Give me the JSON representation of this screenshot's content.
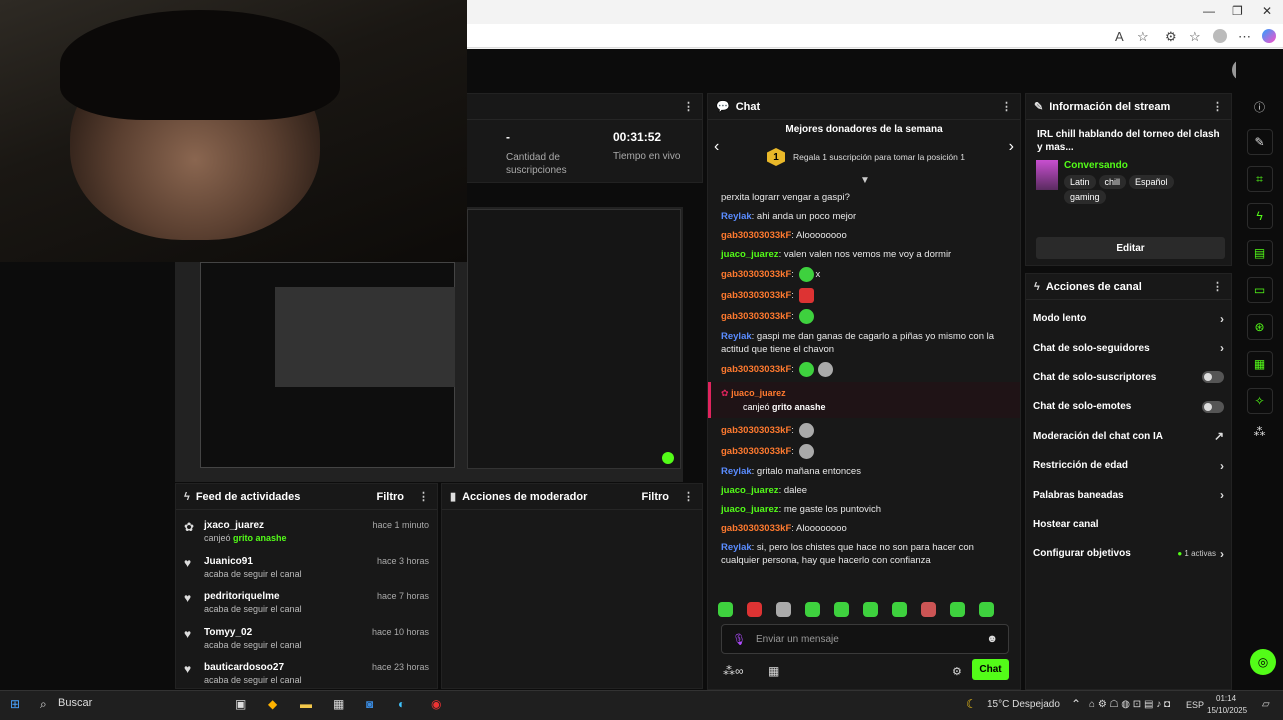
{
  "browser": {
    "window_controls": [
      "—",
      "❐",
      "✕"
    ],
    "address_icons": [
      "text-size",
      "star",
      "extensions",
      "favorites",
      "profile",
      "more",
      "copilot"
    ]
  },
  "stats": {
    "subs_value": "-",
    "subs_label": "Cantidad de suscripciones",
    "live_value": "00:31:52",
    "live_label": "Tiempo en vivo"
  },
  "feed": {
    "title": "Feed de actividades",
    "filter": "Filtro",
    "items": [
      {
        "name": "jxaco_juarez",
        "sub": "canjeó",
        "sub_highlight": "grito anashe",
        "time": "hace 1 minuto",
        "icon": "gift-icon"
      },
      {
        "name": "Juanico91",
        "sub": "acaba de seguir el canal",
        "sub_highlight": "",
        "time": "hace 3 horas",
        "icon": "heart-icon"
      },
      {
        "name": "pedritoriquelme",
        "sub": "acaba de seguir el canal",
        "sub_highlight": "",
        "time": "hace 7 horas",
        "icon": "heart-icon"
      },
      {
        "name": "Tomyy_02",
        "sub": "acaba de seguir el canal",
        "sub_highlight": "",
        "time": "hace 10 horas",
        "icon": "heart-icon"
      },
      {
        "name": "bauticardosoo27",
        "sub": "acaba de seguir el canal",
        "sub_highlight": "",
        "time": "hace 23 horas",
        "icon": "heart-icon"
      }
    ]
  },
  "mod": {
    "title": "Acciones de moderador",
    "filter": "Filtro"
  },
  "chat": {
    "title": "Chat",
    "donors_title": "Mejores donadores de la semana",
    "donors_rank": "1",
    "donors_text": "Regala 1 suscripción para tomar la posición 1",
    "messages": [
      {
        "user": "",
        "cls": "",
        "text": "perxita lograrr vengar a gaspi?",
        "emotes": []
      },
      {
        "user": "Reylak",
        "cls": "u-blue",
        "text": "ahi anda un poco mejor",
        "emotes": []
      },
      {
        "user": "gab30303033kF",
        "cls": "u-orange",
        "text": "Aloooooooo",
        "emotes": []
      },
      {
        "user": "juaco_juarez",
        "cls": "u-green",
        "text": "valen valen nos vemos me voy a dormir",
        "emotes": []
      },
      {
        "user": "gab30303033kF",
        "cls": "u-orange",
        "text": "x",
        "emotes": [
          "green"
        ]
      },
      {
        "user": "gab30303033kF",
        "cls": "u-orange",
        "text": "",
        "emotes": [
          "red"
        ]
      },
      {
        "user": "gab30303033kF",
        "cls": "u-orange",
        "text": "",
        "emotes": [
          "green"
        ]
      },
      {
        "user": "Reylak",
        "cls": "u-blue",
        "text": "gaspi me dan ganas de cagarlo a piñas yo mismo con la actitud que tiene el chavon",
        "emotes": []
      },
      {
        "user": "gab30303033kF",
        "cls": "u-orange",
        "text": "",
        "emotes": [
          "green",
          "gray"
        ]
      }
    ],
    "redeem": {
      "user": "juaco_juarez",
      "text": "canjeó",
      "reward": "grito anashe"
    },
    "messages2": [
      {
        "user": "gab30303033kF",
        "cls": "u-orange",
        "text": "",
        "emotes": [
          "gray"
        ]
      },
      {
        "user": "gab30303033kF",
        "cls": "u-orange",
        "text": "",
        "emotes": [
          "gray"
        ]
      },
      {
        "user": "Reylak",
        "cls": "u-blue",
        "text": "gritalo mañana entonces",
        "emotes": []
      },
      {
        "user": "juaco_juarez",
        "cls": "u-green",
        "text": "dalee",
        "emotes": []
      },
      {
        "user": "juaco_juarez",
        "cls": "u-green",
        "text": "me gaste los puntovich",
        "emotes": []
      },
      {
        "user": "gab30303033kF",
        "cls": "u-orange",
        "text": "Aloooooooo",
        "emotes": []
      },
      {
        "user": "Reylak",
        "cls": "u-blue",
        "text": "si, pero los chistes que hace no son para hacer con cualquier persona, hay que hacerlo con confianza",
        "emotes": []
      }
    ],
    "input_placeholder": "Enviar un mensaje",
    "send_label": "Chat"
  },
  "info": {
    "title": "Información del stream",
    "stream_title": "IRL chill hablando del torneo del clash y mas...",
    "category": "Conversando",
    "tags": [
      "Latin",
      "chill",
      "Español",
      "gaming"
    ],
    "edit_label": "Editar"
  },
  "actions": {
    "title": "Acciones de canal",
    "rows": [
      {
        "label": "Modo lento",
        "kind": "chevron"
      },
      {
        "label": "Chat de solo-seguidores",
        "kind": "chevron"
      },
      {
        "label": "Chat de solo-suscriptores",
        "kind": "toggle"
      },
      {
        "label": "Chat de solo-emotes",
        "kind": "toggle"
      },
      {
        "label": "Moderación del chat con IA",
        "kind": "external"
      },
      {
        "label": "Restricción de edad",
        "kind": "chevron"
      },
      {
        "label": "Palabras baneadas",
        "kind": "chevron"
      },
      {
        "label": "Hostear canal",
        "kind": "none"
      },
      {
        "label": "Configurar objetivos",
        "kind": "badge",
        "badge": "1 activas"
      }
    ]
  },
  "taskbar": {
    "search": "Buscar",
    "weather": "15°C Despejado",
    "lang": "ESP",
    "time": "01:14",
    "date": "15/10/2025"
  },
  "colors": {
    "accent": "#53fc18",
    "panel": "#181818",
    "bg": "#0c0c0c"
  }
}
